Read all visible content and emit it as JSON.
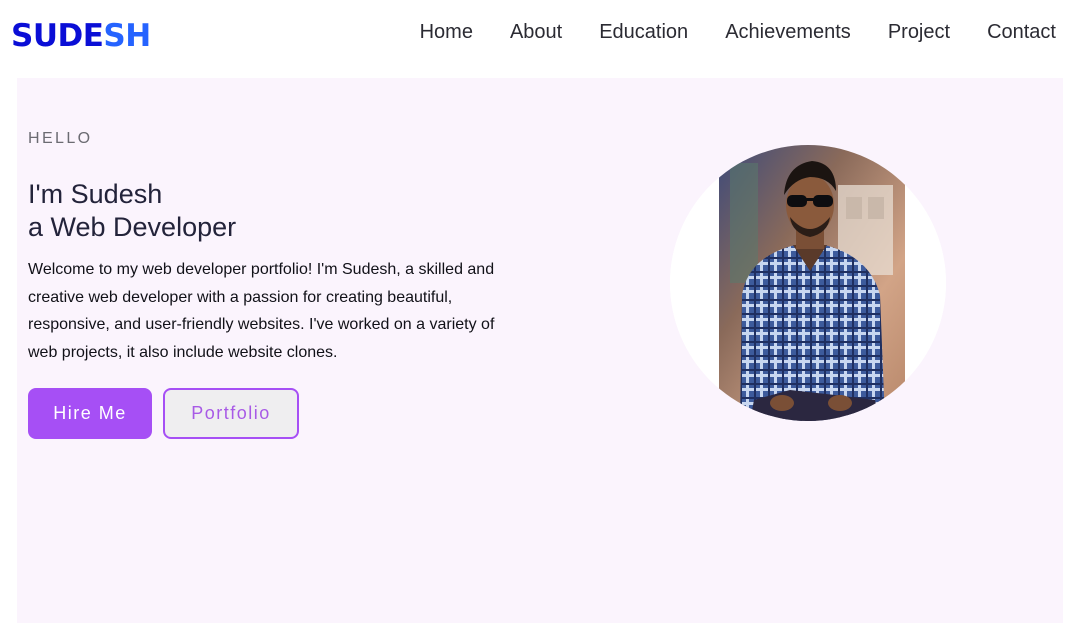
{
  "nav": {
    "logo_part1": "SUDE",
    "logo_part2": "SH",
    "links": [
      "Home",
      "About",
      "Education",
      "Achievements",
      "Project",
      "Contact"
    ]
  },
  "hero": {
    "eyebrow": "HELLO",
    "title_line1": "I'm Sudesh",
    "title_line2": "a Web Developer",
    "description": "Welcome to my web developer portfolio! I'm Sudesh, a skilled and creative web developer with a passion for creating beautiful, responsive, and user-friendly websites. I've worked on a variety of web projects, it also include website clones.",
    "primary_button": "Hire Me",
    "secondary_button": "Portfolio"
  },
  "colors": {
    "logo_dark": "#0a0ed6",
    "logo_light": "#2563ff",
    "accent": "#a64ff5",
    "hero_bg": "#fbf4fd"
  },
  "icons": {
    "profile_photo": "profile-photo"
  }
}
